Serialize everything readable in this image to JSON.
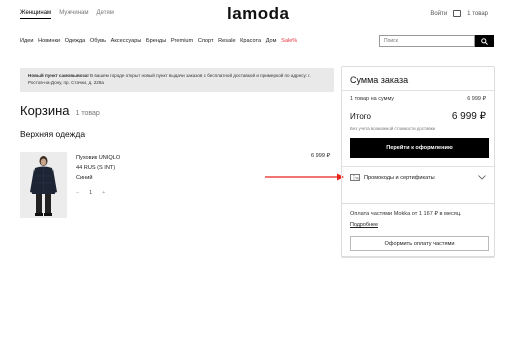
{
  "header": {
    "gender_tabs": [
      "Женщинам",
      "Мужчинам",
      "Детям"
    ],
    "logo": "lamoda",
    "login": "Войти",
    "cart": "1 товар"
  },
  "nav": {
    "categories": [
      "Идеи",
      "Новинки",
      "Одежда",
      "Обувь",
      "Аксессуары",
      "Бренды",
      "Premium",
      "Спорт",
      "Resale",
      "Красота",
      "Дом"
    ],
    "sale": "Sale%"
  },
  "search": {
    "placeholder": "Поиск"
  },
  "banner": {
    "bold": "Новый пункт самовывоза!",
    "text": " В вашем городе открыт новый пункт выдачи заказов с бесплатной доставкой и примеркой по адресу: г. Ростов-на-Дону, пр. Стачки, д. 228а"
  },
  "cart": {
    "title": "Корзина",
    "count": "1 товар",
    "section": "Верхняя одежда",
    "item": {
      "name": "Пуховик UNIQLO",
      "size": "44 RUS (S INT)",
      "color": "Синий",
      "quantity": "1",
      "minus": "–",
      "plus": "+",
      "price": "6 999 ₽"
    }
  },
  "summary": {
    "title": "Сумма заказа",
    "items_label": "1 товар на сумму",
    "items_value": "6 999 ₽",
    "total_label": "Итого",
    "total_value": "6 999 ₽",
    "note": "Без учета возможной стоимости доставки",
    "checkout": "Перейти к оформлению",
    "promo": "Промокоды и сертификаты"
  },
  "mokka": {
    "text": "Оплата частями Mokka от 1 167 ₽ в месяц.",
    "more": "Подробнее",
    "button": "Оформить оплату частями"
  },
  "colors": {
    "accent": "#000000",
    "sale": "#e4343d",
    "arrow": "#e8231a"
  }
}
